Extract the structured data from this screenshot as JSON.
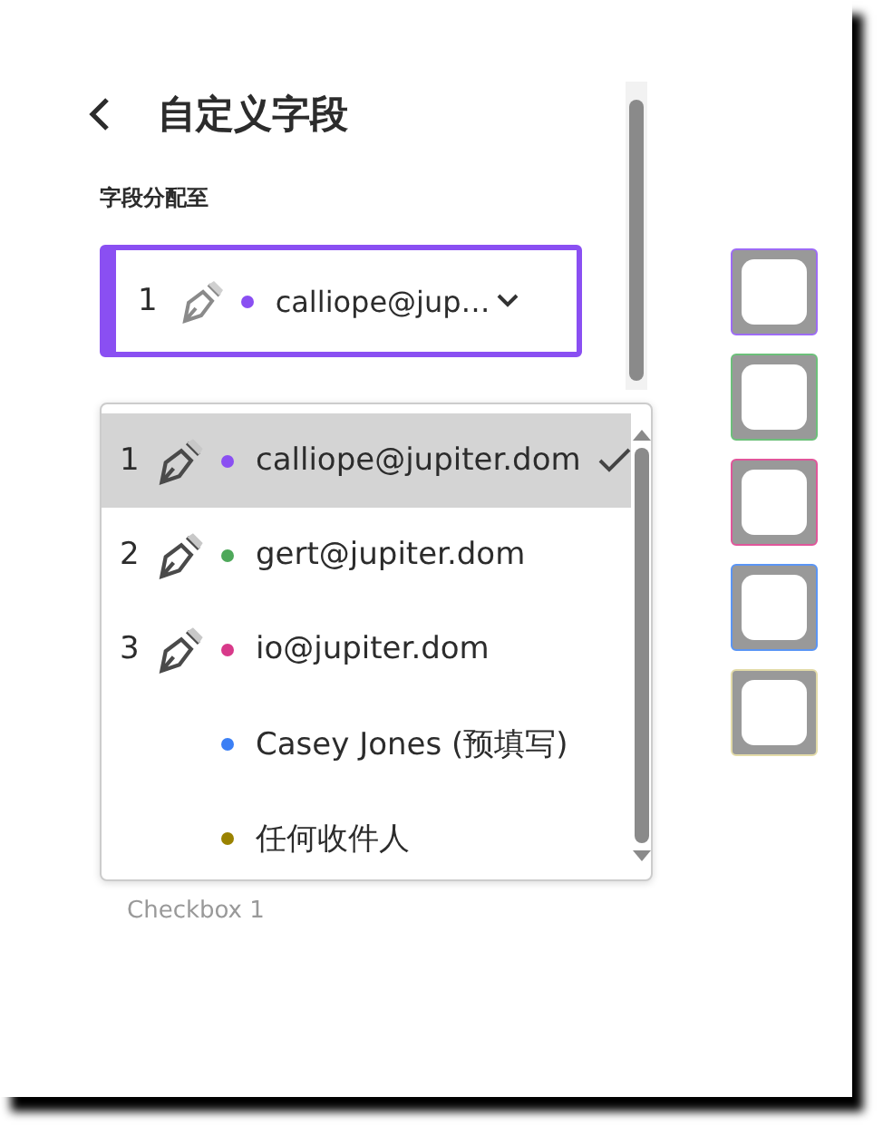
{
  "header": {
    "title": "自定义字段"
  },
  "assign_label": "字段分配至",
  "select": {
    "number": "1",
    "text": "calliope@jup…",
    "color": "#8a4ff2"
  },
  "field_label": "Checkbox 1",
  "dropdown": {
    "items": [
      {
        "kind": "signer",
        "number": "1",
        "text": "calliope@jupiter.dom",
        "color": "#8a4ff2",
        "selected": true
      },
      {
        "kind": "signer",
        "number": "2",
        "text": "gert@jupiter.dom",
        "color": "#4ea85a",
        "selected": false
      },
      {
        "kind": "signer",
        "number": "3",
        "text": "io@jupiter.dom",
        "color": "#d8398a",
        "selected": false
      },
      {
        "kind": "plain",
        "text": "Casey Jones (预填写)",
        "color": "#3b7ff5",
        "selected": false
      },
      {
        "kind": "plain",
        "text": "任何收件人",
        "color": "#9a8200",
        "selected": false
      }
    ]
  },
  "checkboxes": [
    {
      "color": "#9d6bf5"
    },
    {
      "color": "#6cc07a"
    },
    {
      "color": "#e0569a"
    },
    {
      "color": "#5a95f5"
    },
    {
      "color": "#e3dba8"
    }
  ]
}
